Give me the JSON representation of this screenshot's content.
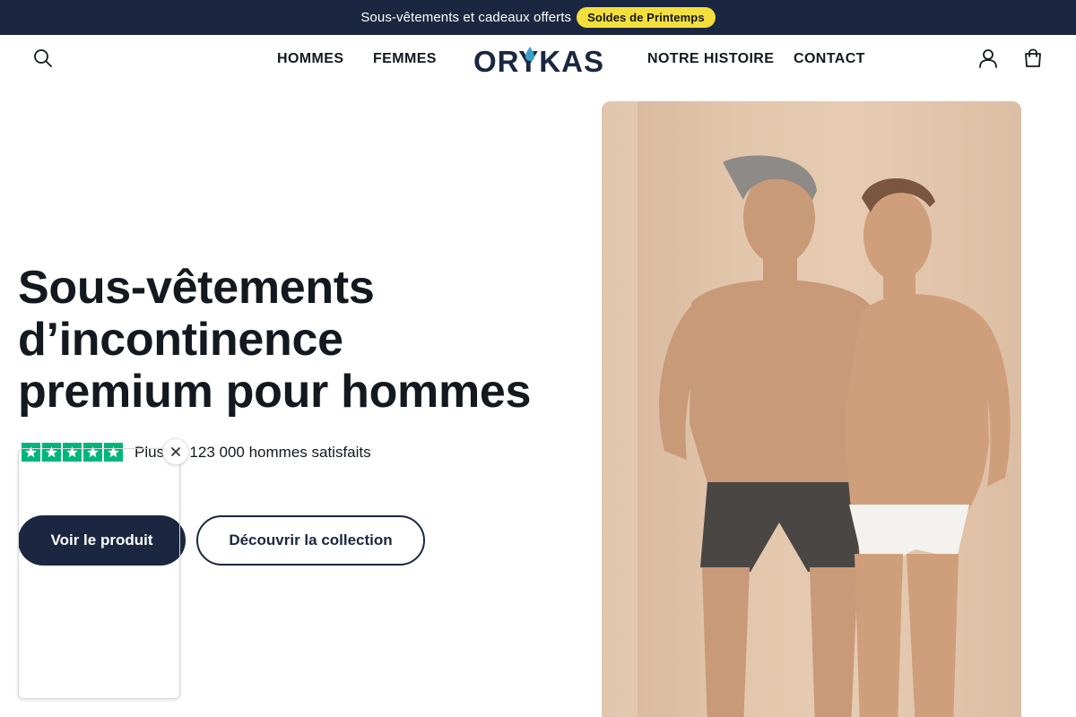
{
  "announcement": {
    "text": "Sous-vêtements et cadeaux offerts",
    "badge": "Soldes de Printemps"
  },
  "header": {
    "nav": [
      "HOMMES",
      "FEMMES",
      "NOTRE HISTOIRE",
      "CONTACT"
    ],
    "logo": "ORYKAS",
    "icons": [
      "search-icon",
      "account-icon",
      "cart-icon"
    ]
  },
  "hero": {
    "title_lines": [
      "Sous-vêtements",
      "d’incontinence",
      "premium pour hommes"
    ],
    "rating_text": "Plus de 123 000 hommes satisfaits",
    "rating_stars": 5,
    "primary_cta": "Voir le produit",
    "secondary_cta": "Découvrir la collection"
  },
  "colors": {
    "navy": "#1b2740",
    "badge_yellow": "#f2df3c",
    "trustpilot_green": "#00b67a",
    "logo_drop": "#3aa0c8"
  }
}
